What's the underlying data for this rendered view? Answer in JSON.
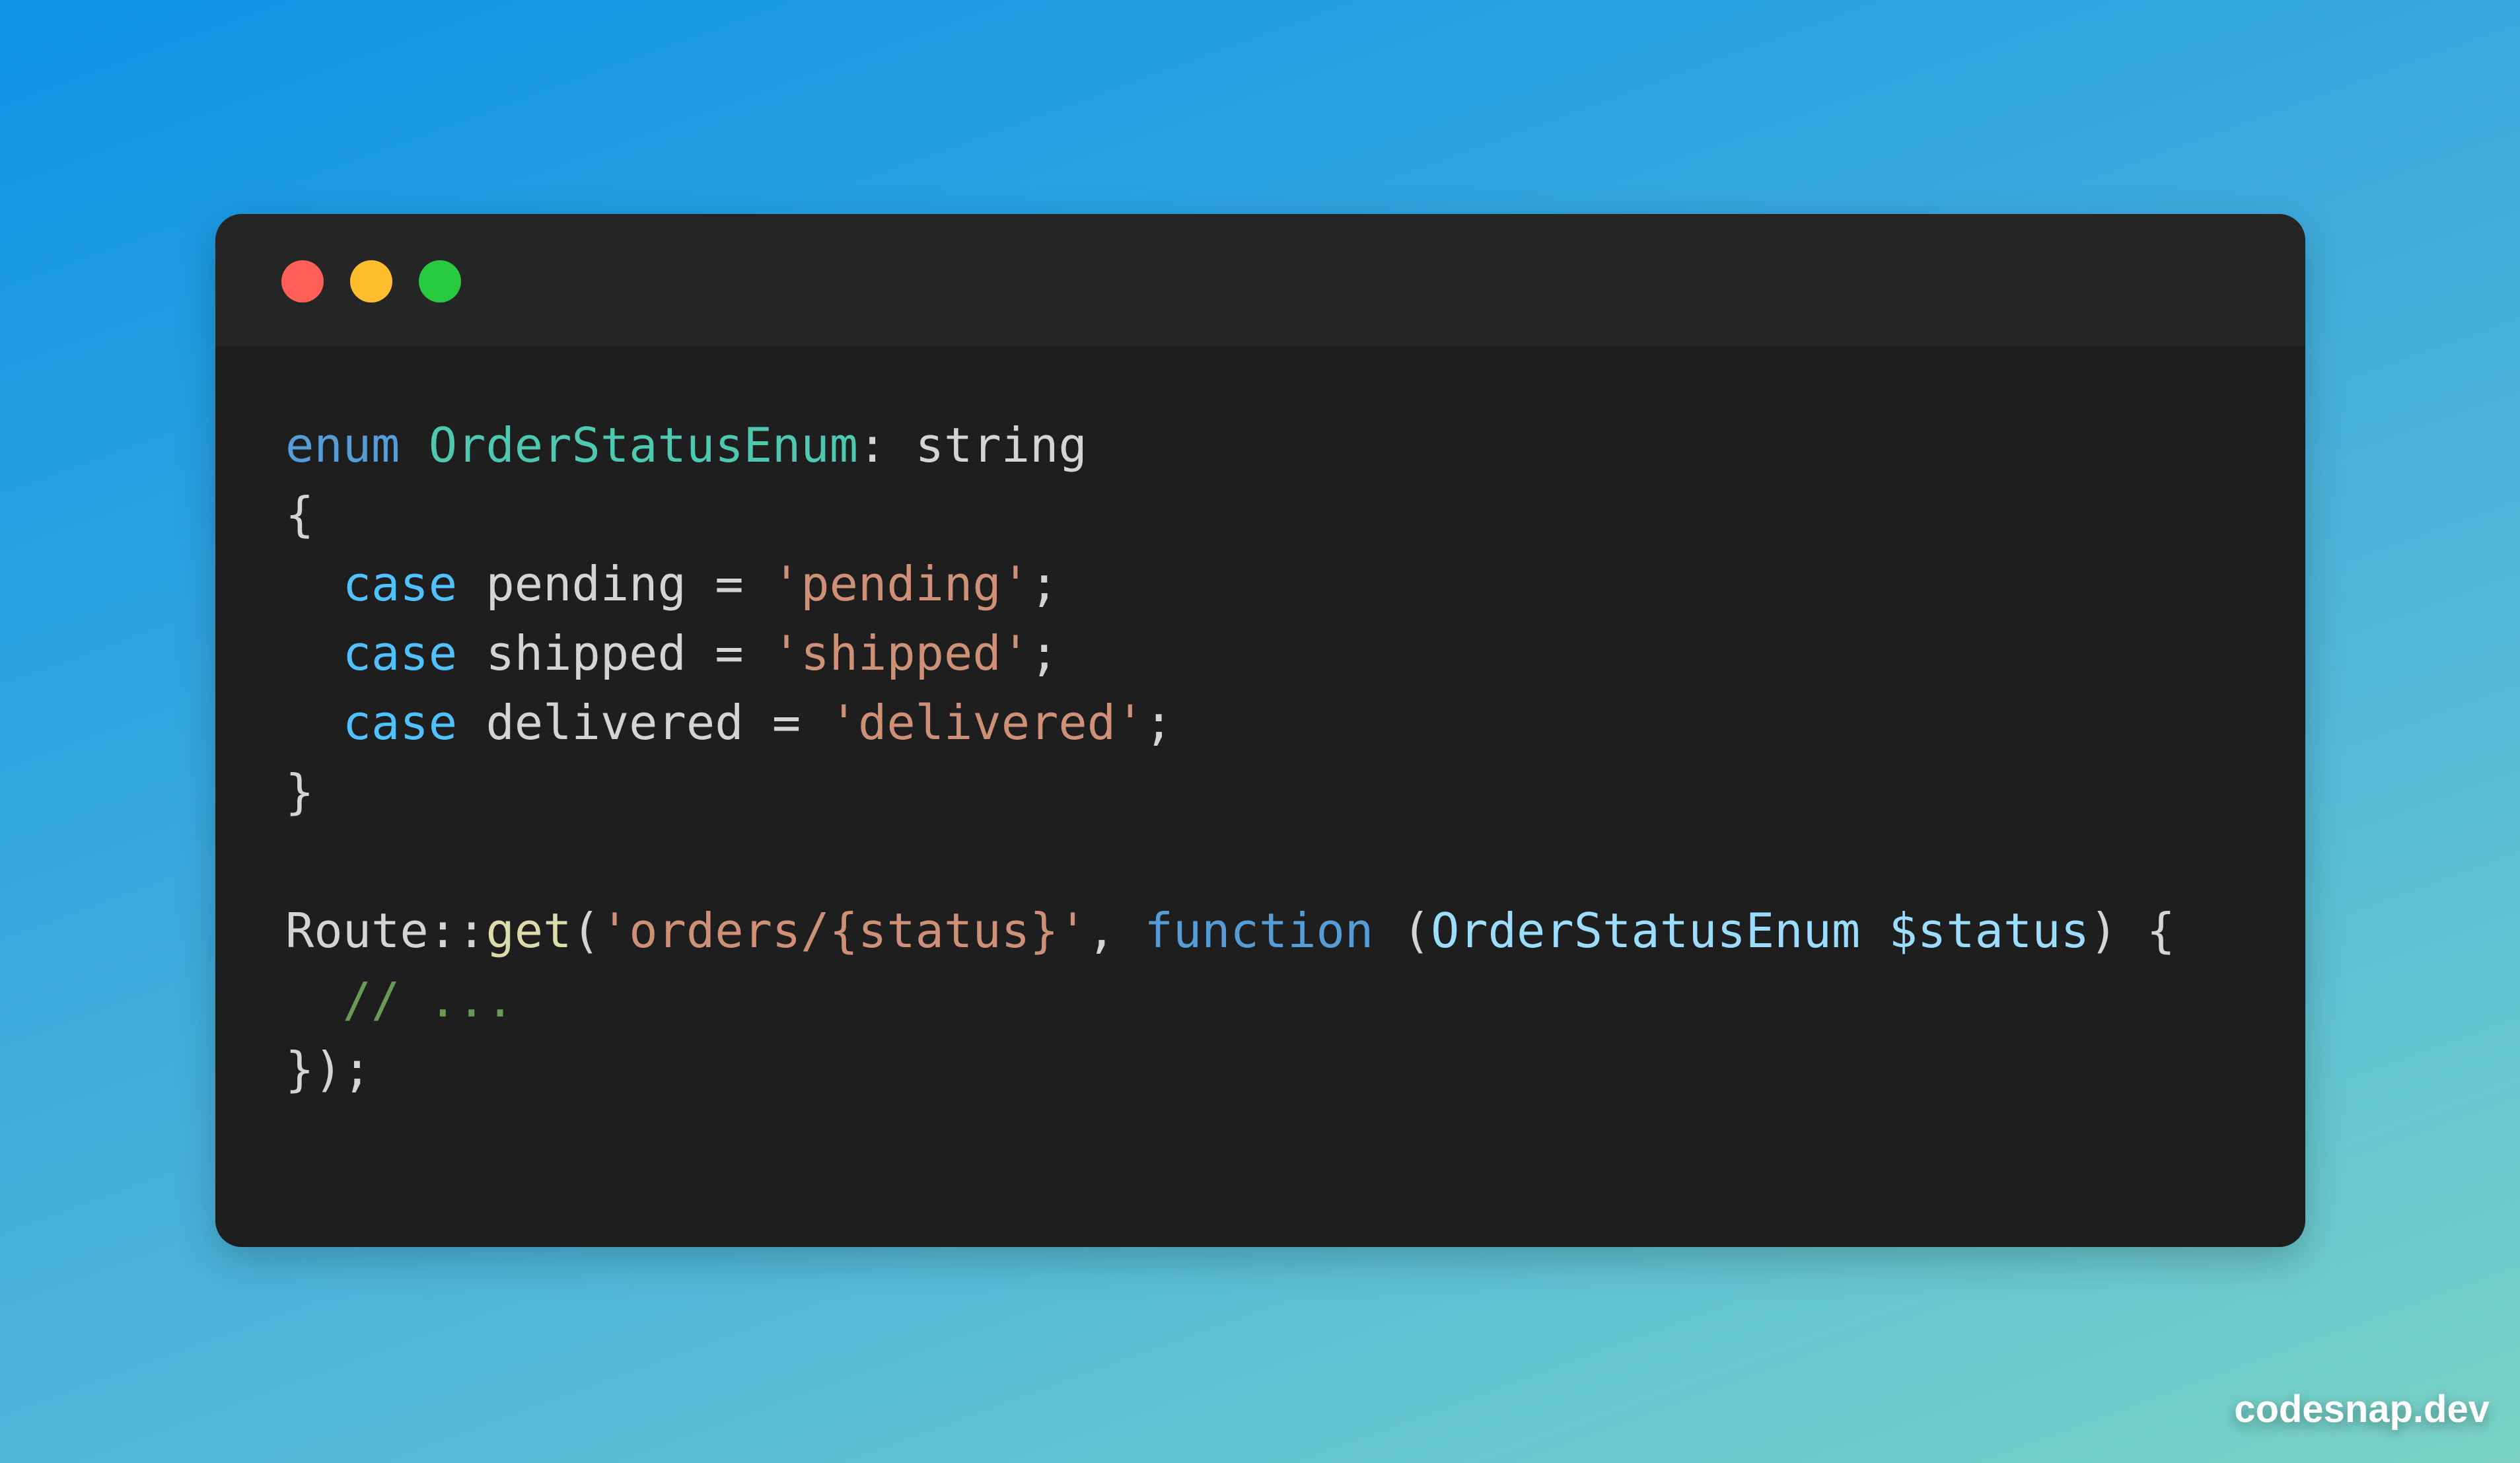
{
  "window": {
    "traffic_lights": [
      "close-icon",
      "minimize-icon",
      "maximize-icon"
    ],
    "traffic_colors": [
      "#ff5f56",
      "#ffbd2e",
      "#27c93f"
    ]
  },
  "code_lines": [
    [
      {
        "text": "enum",
        "color": "#569cd6"
      },
      {
        "text": " ",
        "color": "#d4d4d4"
      },
      {
        "text": "OrderStatusEnum",
        "color": "#4ec9b0"
      },
      {
        "text": ": string",
        "color": "#d4d4d4"
      }
    ],
    [
      {
        "text": "{",
        "color": "#d4d4d4"
      }
    ],
    [
      {
        "text": "  ",
        "color": "#d4d4d4"
      },
      {
        "text": "case",
        "color": "#4fc1ff"
      },
      {
        "text": " pending = ",
        "color": "#d4d4d4"
      },
      {
        "text": "'pending'",
        "color": "#ce9178"
      },
      {
        "text": ";",
        "color": "#d4d4d4"
      }
    ],
    [
      {
        "text": "  ",
        "color": "#d4d4d4"
      },
      {
        "text": "case",
        "color": "#4fc1ff"
      },
      {
        "text": " shipped = ",
        "color": "#d4d4d4"
      },
      {
        "text": "'shipped'",
        "color": "#ce9178"
      },
      {
        "text": ";",
        "color": "#d4d4d4"
      }
    ],
    [
      {
        "text": "  ",
        "color": "#d4d4d4"
      },
      {
        "text": "case",
        "color": "#4fc1ff"
      },
      {
        "text": " delivered = ",
        "color": "#d4d4d4"
      },
      {
        "text": "'delivered'",
        "color": "#ce9178"
      },
      {
        "text": ";",
        "color": "#d4d4d4"
      }
    ],
    [
      {
        "text": "}",
        "color": "#d4d4d4"
      }
    ],
    [
      {
        "text": "",
        "color": "#d4d4d4"
      }
    ],
    [
      {
        "text": "Route::",
        "color": "#d4d4d4"
      },
      {
        "text": "get",
        "color": "#dcdcaa"
      },
      {
        "text": "(",
        "color": "#d4d4d4"
      },
      {
        "text": "'orders/{status}'",
        "color": "#ce9178"
      },
      {
        "text": ", ",
        "color": "#d4d4d4"
      },
      {
        "text": "function",
        "color": "#569cd6"
      },
      {
        "text": " (",
        "color": "#d4d4d4"
      },
      {
        "text": "OrderStatusEnum",
        "color": "#9cdcfe"
      },
      {
        "text": " ",
        "color": "#d4d4d4"
      },
      {
        "text": "$status",
        "color": "#9cdcfe"
      },
      {
        "text": ") {",
        "color": "#d4d4d4"
      }
    ],
    [
      {
        "text": "  ",
        "color": "#d4d4d4"
      },
      {
        "text": "// ...",
        "color": "#6a9955"
      }
    ],
    [
      {
        "text": "});",
        "color": "#d4d4d4"
      }
    ]
  ],
  "watermark": "codesnap.dev"
}
